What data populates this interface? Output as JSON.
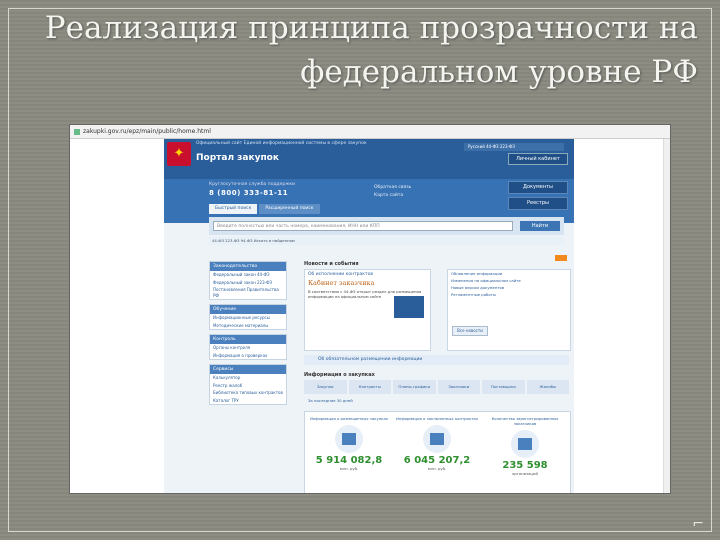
{
  "slide": {
    "title_line1": "Реализация принципа прозрачности на",
    "title_line2": "федеральном уровне РФ"
  },
  "browser": {
    "address": "zakupki.gov.ru/epz/main/public/home.html"
  },
  "site": {
    "top_text": "Официальный сайт Единой информационной системы в сфере закупок",
    "portal": "Портал закупок",
    "top_nav": "Русский  44-ФЗ  223-ФЗ",
    "login_button": "Личный кабинет",
    "phone_label": "Круглосуточная служба поддержки",
    "phone": "8 (800) 333-81-11",
    "mid_link_1": "Обратная связь",
    "mid_link_2": "Карта сайта",
    "side_buttons": [
      "Документы",
      "Реестры"
    ],
    "tabs": [
      "Быстрый поиск",
      "Расширенный поиск"
    ],
    "search_placeholder": "Введите полностью или часть номера, наименования, ИНН или КПП",
    "search_button": "Найти",
    "filters": "44-ФЗ   223-ФЗ   94-ФЗ      Искать в найденном",
    "left_boxes": [
      {
        "head": "Законодательство",
        "items": [
          "Федеральный закон 44-ФЗ",
          "Федеральный закон 223-ФЗ",
          "Постановления Правительства РФ"
        ]
      },
      {
        "head": "Обучение",
        "items": [
          "Информационные ресурсы",
          "Методические материалы"
        ]
      },
      {
        "head": "Контроль",
        "items": [
          "Органы контроля",
          "Информация о проверках"
        ]
      },
      {
        "head": "Сервисы",
        "items": [
          "Калькулятор",
          "Реестр жалоб",
          "Библиотека типовых контрактов",
          "Каталог ТРУ"
        ]
      }
    ],
    "news_head": "Новости и события",
    "news_cap": "Об исполнении контрактов",
    "news_big": "Кабинет заказчика",
    "news_small": "В соответствии с 44-ФЗ открыт раздел для размещения информации на официальном сайте",
    "news_right": [
      {
        "date": "",
        "text": "Обновление информации"
      },
      {
        "date": "",
        "text": "Изменения на официальном сайте"
      },
      {
        "date": "",
        "text": "Новые версии документов"
      },
      {
        "date": "",
        "text": "Регламентные работы"
      }
    ],
    "news_more": "Все новости",
    "strip": "Об обязательном размещении информации",
    "info_title": "Информация о закупках",
    "info_tabs": [
      "Закупки",
      "Контракты",
      "Планы-графики",
      "Заказчики",
      "Поставщики",
      "Жалобы"
    ],
    "info_sub": "За последние 30 дней",
    "stats": [
      {
        "label": "Информация о размещенных закупках",
        "number": "5 914 082,8",
        "unit": "млн. руб."
      },
      {
        "label": "Информация о заключенных контрактах",
        "number": "6 045 207,2",
        "unit": "млн. руб."
      },
      {
        "label": "Количество зарегистрированных заказчиков",
        "number": "235 598",
        "unit": "организаций"
      }
    ]
  },
  "colors": {
    "header_dark": "#2a5e9b",
    "header_mid": "#3772b4",
    "stat_number": "#2f8f2f"
  }
}
